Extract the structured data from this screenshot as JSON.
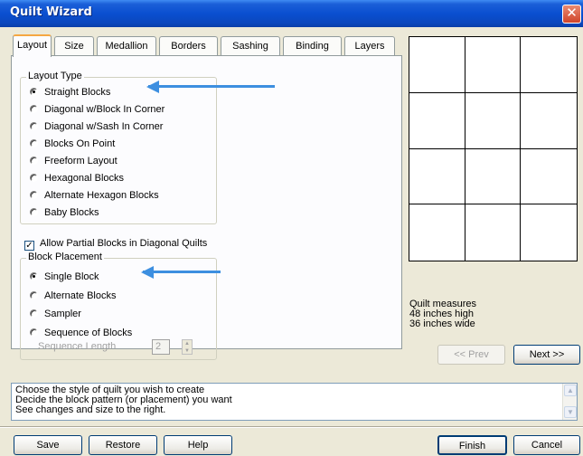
{
  "window": {
    "title": "Quilt Wizard",
    "close_symbol": "✕"
  },
  "tabs": [
    {
      "label": "Layout",
      "active": true
    },
    {
      "label": "Size"
    },
    {
      "label": "Medallion"
    },
    {
      "label": "Borders"
    },
    {
      "label": "Sashing"
    },
    {
      "label": "Binding"
    },
    {
      "label": "Layers"
    }
  ],
  "layout_type": {
    "label": "Layout Type",
    "options": [
      {
        "label": "Straight Blocks",
        "selected": true
      },
      {
        "label": "Diagonal w/Block In Corner"
      },
      {
        "label": "Diagonal w/Sash In Corner"
      },
      {
        "label": "Blocks On Point"
      },
      {
        "label": "Freeform Layout"
      },
      {
        "label": "Hexagonal Blocks"
      },
      {
        "label": "Alternate Hexagon Blocks"
      },
      {
        "label": "Baby Blocks"
      }
    ]
  },
  "allow_partial": {
    "label": "Allow Partial Blocks in Diagonal Quilts",
    "checked": true,
    "check_mark": "✓"
  },
  "block_placement": {
    "label": "Block Placement",
    "options": [
      {
        "label": "Single Block",
        "selected": true
      },
      {
        "label": "Alternate Blocks"
      },
      {
        "label": "Sampler"
      },
      {
        "label": "Sequence of Blocks"
      }
    ],
    "sequence_length_label": "Sequence Length",
    "sequence_length_value": "2",
    "spin_up": "▲",
    "spin_down": "▼"
  },
  "measures": {
    "line1": "Quilt measures",
    "line2": "48 inches high",
    "line3": "36 inches wide"
  },
  "nav": {
    "prev": "<< Prev",
    "next": "Next >>"
  },
  "info": {
    "lines": [
      "Choose the style of quilt you wish to create",
      "Decide the block pattern (or placement) you want",
      "See changes and size to the right."
    ],
    "scroll_up": "▲",
    "scroll_down": "▼"
  },
  "buttons": {
    "save": "Save",
    "restore": "Restore",
    "help": "Help",
    "finish": "Finish",
    "cancel": "Cancel"
  },
  "colors": {
    "title_bar": "#0a4fd0",
    "arrow": "#3d8fe0",
    "active_tab_accent": "#f5a742"
  },
  "preview_grid": {
    "columns": 3,
    "rows": 4
  }
}
